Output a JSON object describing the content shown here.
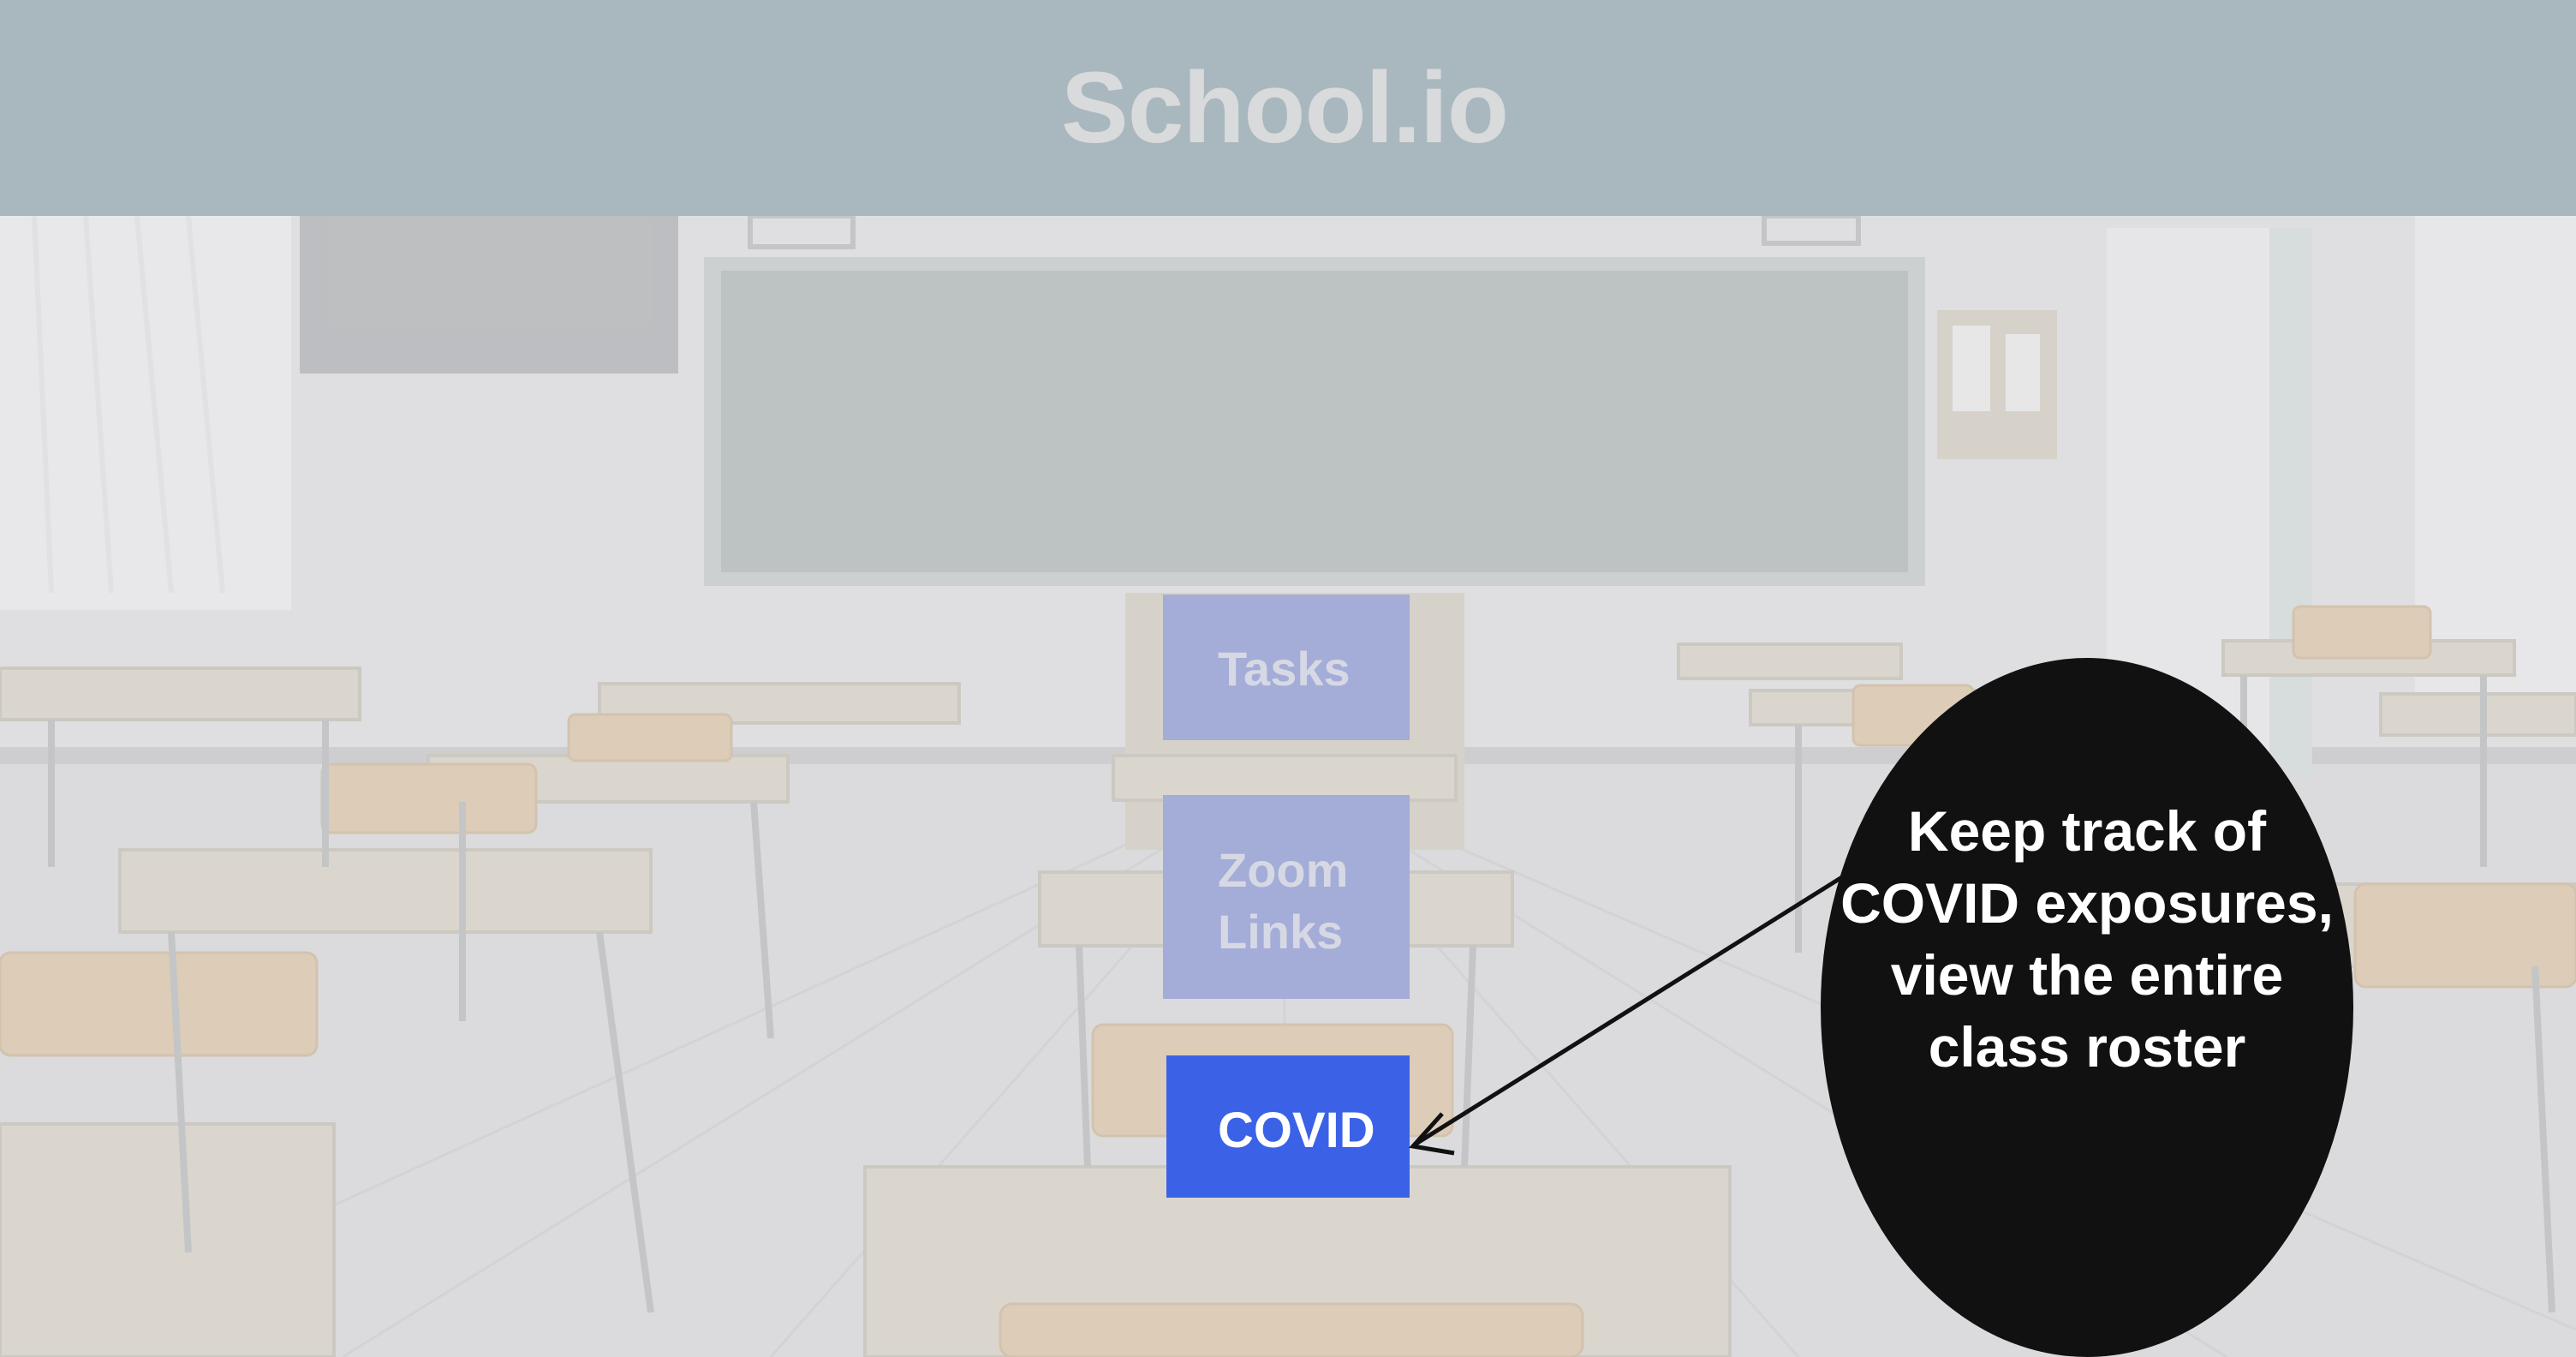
{
  "app": {
    "title": "School.io"
  },
  "menu": {
    "tasks_label": "Tasks",
    "zoom_label": "Zoom Links",
    "covid_label": "COVID"
  },
  "callout": {
    "text": "Keep track of COVID exposures, view the entire class roster"
  },
  "colors": {
    "header_bg": "#a9b8bf",
    "button_inactive": "#a4acd8",
    "button_active": "#3b62e6",
    "callout_bg": "#111111"
  }
}
